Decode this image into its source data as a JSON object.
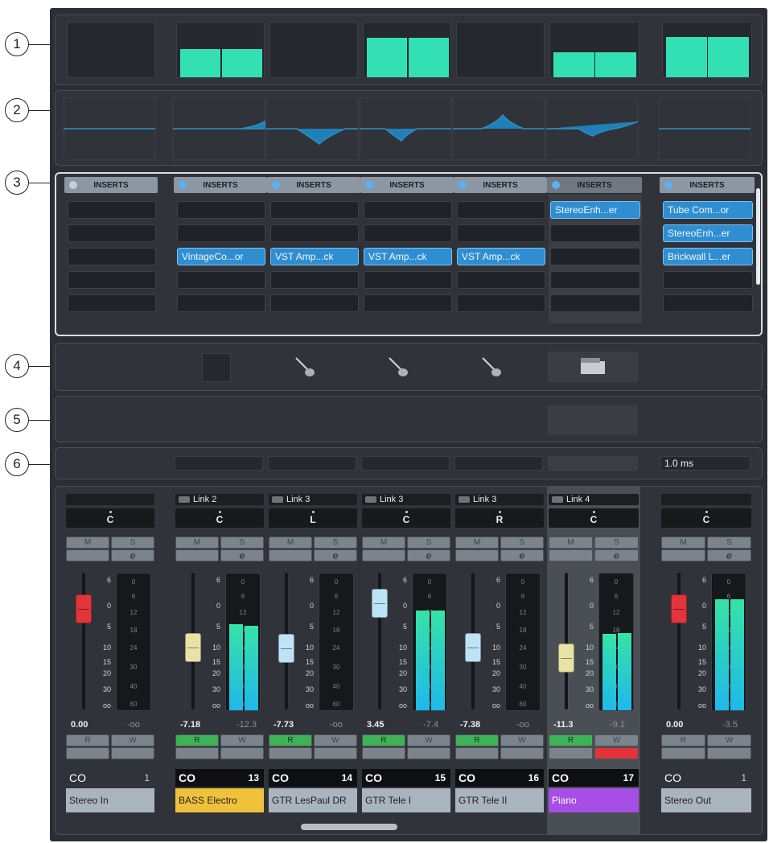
{
  "callouts": [
    "1",
    "2",
    "3",
    "4",
    "5",
    "6"
  ],
  "sections": {
    "meters": {
      "levels": [
        0,
        0.5,
        0,
        0.7,
        0,
        0.45,
        0.72
      ]
    },
    "inserts": {
      "header_label": "INSERTS",
      "columns": [
        {
          "slots": [
            "",
            "",
            "",
            "",
            ""
          ]
        },
        {
          "slots": [
            "",
            "",
            "VintageCo...or",
            "",
            ""
          ]
        },
        {
          "slots": [
            "",
            "",
            "VST Amp...ck",
            "",
            ""
          ]
        },
        {
          "slots": [
            "",
            "",
            "VST Amp...ck",
            "",
            ""
          ]
        },
        {
          "slots": [
            "",
            "",
            "VST Amp...ck",
            "",
            ""
          ]
        },
        {
          "slots": [
            "StereoEnh...er",
            "",
            "",
            "",
            ""
          ]
        },
        {
          "slots": [
            "Tube Com...or",
            "StereoEnh...er",
            "Brickwall L...er",
            "",
            ""
          ]
        }
      ]
    },
    "pictures": [
      "",
      "blank-picture-icon",
      "guitar-icon",
      "guitar-icon",
      "guitar-icon",
      "piano-icon",
      ""
    ],
    "latency": {
      "stereo_out": "1.0 ms"
    }
  },
  "channels": [
    {
      "link": "",
      "pan": "C",
      "fader_value": "0.00",
      "peak": "-oo",
      "number": "1",
      "name": "Stereo In",
      "name_color": "#aab4be",
      "name_text": "#1d2024",
      "cap_color": "#e1353b",
      "fader_level": 0.1,
      "meter": [
        0,
        0
      ]
    },
    {
      "link": "Link 2",
      "pan": "C",
      "fader_value": "-7.18",
      "peak": "-12.3",
      "number": "13",
      "name": "BASS Electro",
      "name_color": "#f0c23c",
      "name_text": "#1d2024",
      "cap_color": "#e7e3a7",
      "fader_level": 0.38,
      "meter": [
        0.62,
        0.61
      ]
    },
    {
      "link": "Link 3",
      "pan": "L",
      "fader_value": "-7.73",
      "peak": "-oo",
      "number": "14",
      "name": "GTR LesPaul DR",
      "name_color": "#aab4be",
      "name_text": "#1d2024",
      "cap_color": "#bde3f7",
      "fader_level": 0.39,
      "meter": [
        0,
        0
      ]
    },
    {
      "link": "Link 3",
      "pan": "C",
      "fader_value": "3.45",
      "peak": "-7.4",
      "number": "15",
      "name": "GTR Tele I",
      "name_color": "#aab4be",
      "name_text": "#1d2024",
      "cap_color": "#bde3f7",
      "fader_level": 0.06,
      "meter": [
        0.72,
        0.72
      ]
    },
    {
      "link": "Link 3",
      "pan": "R",
      "fader_value": "-7.38",
      "peak": "-oo",
      "number": "16",
      "name": "GTR Tele II",
      "name_color": "#aab4be",
      "name_text": "#1d2024",
      "cap_color": "#bde3f7",
      "fader_level": 0.38,
      "meter": [
        0,
        0
      ]
    },
    {
      "link": "Link 4",
      "pan": "C",
      "fader_value": "-11.3",
      "peak": "-9.1",
      "number": "17",
      "name": "Piano",
      "name_color": "#a74ee6",
      "name_text": "#ffffff",
      "cap_color": "#e7e3a7",
      "fader_level": 0.46,
      "meter": [
        0.55,
        0.56
      ]
    },
    {
      "link": "",
      "pan": "C",
      "fader_value": "0.00",
      "peak": "-3.5",
      "number": "1",
      "name": "Stereo Out",
      "name_color": "#aab4be",
      "name_text": "#1d2024",
      "cap_color": "#e1353b",
      "fader_level": 0.1,
      "meter": [
        0.8,
        0.8
      ]
    }
  ],
  "buttons": {
    "mute": "M",
    "solo": "S",
    "edit": "e",
    "read": "R",
    "write": "W"
  },
  "fader_scale": [
    "6",
    "0",
    "5",
    "10",
    "15",
    "20",
    "30",
    "oo"
  ],
  "meter_scale": [
    "0",
    "6",
    "12",
    "18",
    "24",
    "30",
    "40",
    "60"
  ]
}
